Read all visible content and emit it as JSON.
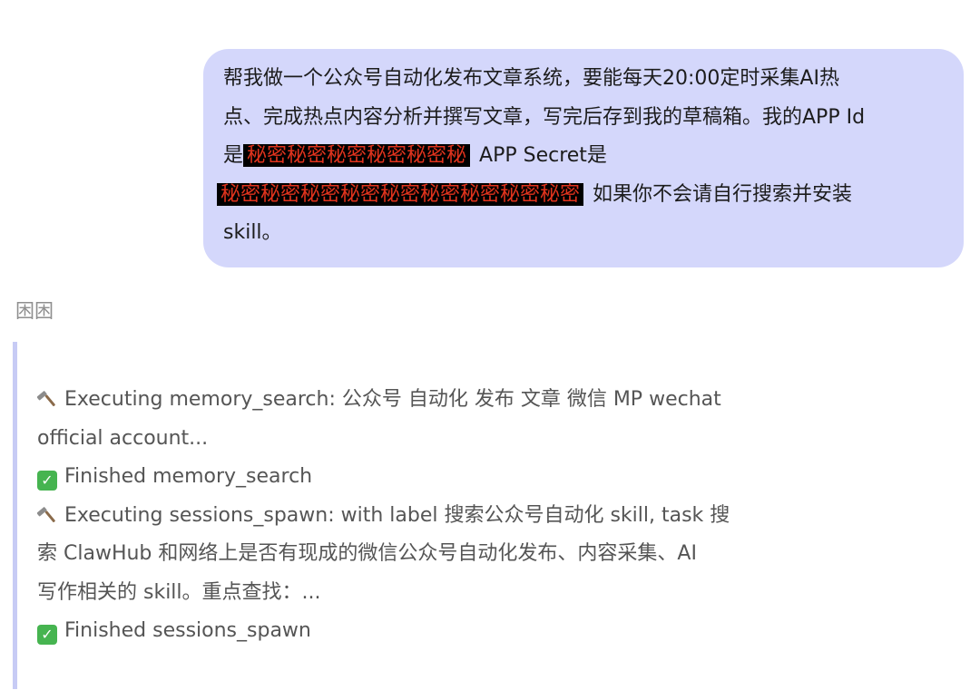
{
  "user_message": {
    "line1": "帮我做一个公众号自动化发布文章系统，要能每天20:00定时采集AI热",
    "line2": "点、完成热点内容分析并撰写文章，写完后存到我的草稿箱。我的APP Id",
    "line3_prefix": "是",
    "app_id_redacted": "秘密秘密秘密秘密秘密秘",
    "line3_suffix": "APP Secret是",
    "app_secret_redacted": "秘密秘密秘密秘密秘密秘密秘密秘密秘密",
    "line4_suffix": "如果你不会请自行搜索并安装",
    "line5": "skill。"
  },
  "assistant": {
    "sender_name": "困困",
    "lines": {
      "exec1_a": "Executing memory_search: 公众号 自动化 发布 文章 微信 MP wechat",
      "exec1_b": "official account...",
      "done1": "Finished memory_search",
      "exec2_a": "Executing sessions_spawn: with label 搜索公众号自动化 skill, task 搜",
      "exec2_b": "索 ClawHub 和网络上是否有现成的微信公众号自动化发布、内容采集、AI",
      "exec2_c": "写作相关的 skill。重点查找：...",
      "done2": "Finished sessions_spawn"
    }
  },
  "icons": {
    "hammer": "hammer-icon",
    "check": "check-mark-icon"
  },
  "colors": {
    "bubble_bg": "#d4d7fb",
    "quote_bar": "#c7cbf5",
    "redacted_text": "#e0331d",
    "check_green": "#46b450"
  }
}
